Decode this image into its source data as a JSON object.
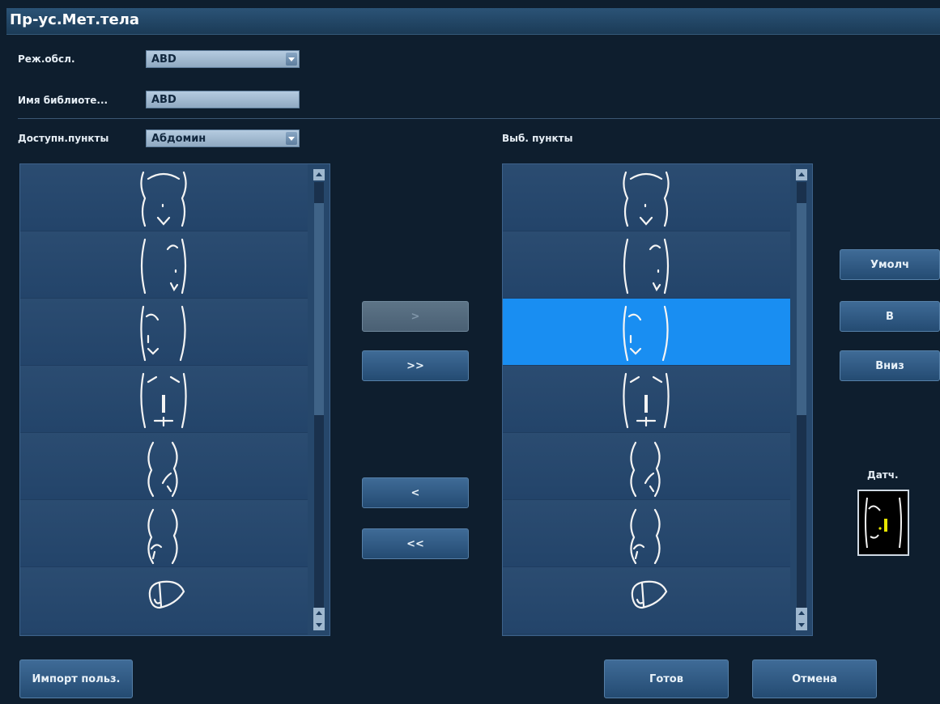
{
  "window": {
    "title": "Пр-ус.Мет.тела"
  },
  "form": {
    "exam_label": "Реж.обсл.",
    "exam_value": "ABD",
    "library_label": "Имя библиоте...",
    "library_value": "ABD",
    "available_label": "Доступн.пункты",
    "available_value": "Абдомин",
    "selected_label": "Выб. пункты"
  },
  "available_list": {
    "items": [
      "abdomen-upper",
      "abdomen-right-upper",
      "abdomen-right",
      "abdomen-center",
      "torso-left",
      "torso-right",
      "liver"
    ]
  },
  "selected_list": {
    "items": [
      "abdomen-upper",
      "abdomen-right-upper",
      "abdomen-right",
      "abdomen-center",
      "torso-left",
      "torso-right",
      "liver"
    ],
    "selected_index": 2
  },
  "transfer": {
    "add_label": ">",
    "add_all_label": ">>",
    "remove_label": "<",
    "remove_all_label": "<<"
  },
  "side_buttons": {
    "default_label": "Умолч",
    "up_label": "В",
    "down_label": "Вниз"
  },
  "probe": {
    "label": "Датч.",
    "icon": "body-mark-probe-icon"
  },
  "footer": {
    "import_label": "Импорт польз.",
    "done_label": "Готов",
    "cancel_label": "Отмена"
  },
  "colors": {
    "selected_row": "#198ef2",
    "list_bg": "#26476b",
    "background": "#0e1e2e"
  }
}
